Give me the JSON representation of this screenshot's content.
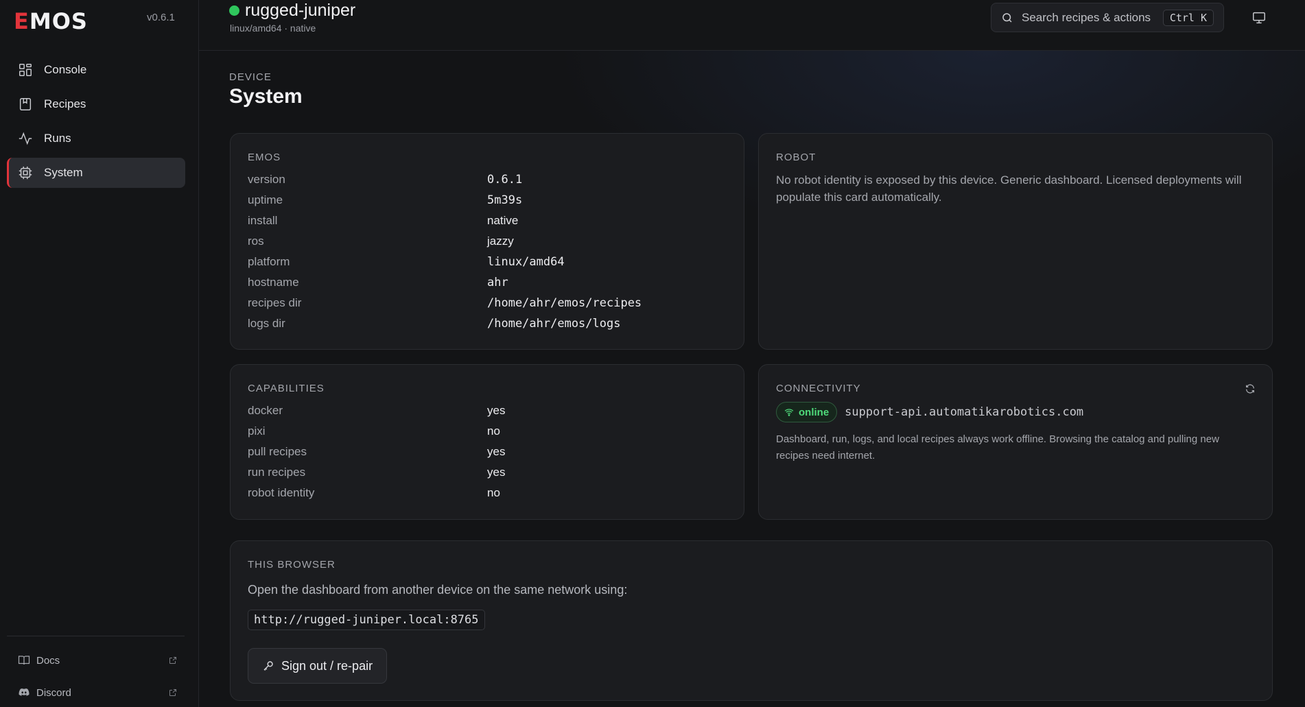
{
  "sidebar": {
    "logo_first": "E",
    "logo_rest": "MOS",
    "version": "v0.6.1",
    "nav": [
      {
        "label": "Console",
        "icon": "grid-icon"
      },
      {
        "label": "Recipes",
        "icon": "book-icon"
      },
      {
        "label": "Runs",
        "icon": "activity-icon"
      },
      {
        "label": "System",
        "icon": "cpu-icon",
        "active": true
      }
    ],
    "footer": [
      {
        "label": "Docs",
        "icon": "book-open-icon"
      },
      {
        "label": "Discord",
        "icon": "discord-icon"
      }
    ]
  },
  "topbar": {
    "host_name": "rugged-juniper",
    "host_sub": "linux/amd64 · native",
    "status_color": "#2fc65c",
    "search_placeholder": "Search recipes & actions",
    "search_shortcut": "Ctrl K"
  },
  "page": {
    "label": "DEVICE",
    "title": "System"
  },
  "emos_card": {
    "title": "EMOS",
    "rows": [
      {
        "key": "version",
        "value": "0.6.1"
      },
      {
        "key": "uptime",
        "value": "5m39s"
      },
      {
        "key": "install",
        "value": "native"
      },
      {
        "key": "ros",
        "value": "jazzy"
      },
      {
        "key": "platform",
        "value": "linux/amd64"
      },
      {
        "key": "hostname",
        "value": "ahr"
      },
      {
        "key": "recipes dir",
        "value": "/home/ahr/emos/recipes"
      },
      {
        "key": "logs dir",
        "value": "/home/ahr/emos/logs"
      }
    ]
  },
  "robot_card": {
    "title": "ROBOT",
    "text": "No robot identity is exposed by this device. Generic dashboard. Licensed deployments will populate this card automatically."
  },
  "capabilities_card": {
    "title": "CAPABILITIES",
    "rows": [
      {
        "key": "docker",
        "value": "yes"
      },
      {
        "key": "pixi",
        "value": "no"
      },
      {
        "key": "pull recipes",
        "value": "yes"
      },
      {
        "key": "run recipes",
        "value": "yes"
      },
      {
        "key": "robot identity",
        "value": "no"
      }
    ]
  },
  "connectivity_card": {
    "title": "CONNECTIVITY",
    "status": "online",
    "host": "support-api.automatikarobotics.com",
    "note": "Dashboard, run, logs, and local recipes always work offline. Browsing the catalog and pulling new recipes need internet."
  },
  "browser_card": {
    "title": "THIS BROWSER",
    "text": "Open the dashboard from another device on the same network using:",
    "url": "http://rugged-juniper.local:8765",
    "signout_label": "Sign out / re-pair"
  }
}
